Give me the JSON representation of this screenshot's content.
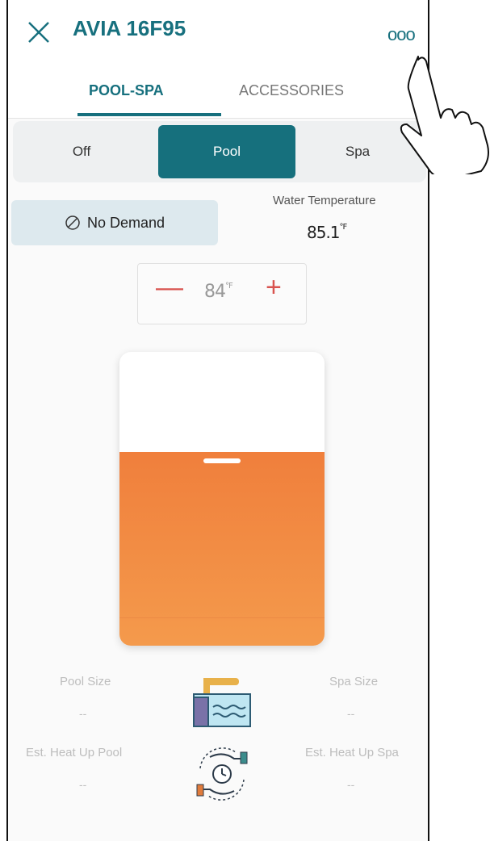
{
  "header": {
    "title": "AVIA 16F95",
    "more_label": "ooo"
  },
  "tabs": [
    {
      "label": "POOL-SPA",
      "active": true
    },
    {
      "label": "ACCESSORIES",
      "active": false
    }
  ],
  "modes": {
    "off": "Off",
    "pool": "Pool",
    "spa": "Spa",
    "selected": "Pool"
  },
  "status": {
    "demand": "No Demand"
  },
  "water_temperature": {
    "label": "Water Temperature",
    "value": "85.1",
    "unit": "°F"
  },
  "setpoint": {
    "value": "84",
    "unit": "°F",
    "minus": "—",
    "plus": "+"
  },
  "gauge": {
    "fill_fraction": 0.66,
    "color": "#f07f3c"
  },
  "info": {
    "pool_size_label": "Pool Size",
    "pool_size_value": "--",
    "spa_size_label": "Spa Size",
    "spa_size_value": "--",
    "heat_pool_label": "Est. Heat Up Pool",
    "heat_pool_value": "--",
    "heat_spa_label": "Est. Heat Up Spa",
    "heat_spa_value": "--"
  },
  "colors": {
    "accent": "#16707d",
    "minus_plus": "#d9534f"
  }
}
